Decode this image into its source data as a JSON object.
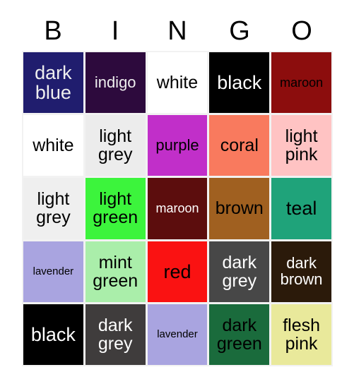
{
  "card": {
    "title": "BINGO",
    "header_letters": [
      "B",
      "I",
      "N",
      "G",
      "O"
    ],
    "background_color": "#ffffff",
    "grid_gap_color": "#f2f2f2"
  },
  "grid": {
    "columns": 5,
    "rows": 5,
    "cells": [
      [
        {
          "label": "dark blue",
          "bg": "#201d6e",
          "fg": "#eeeeee",
          "size": "fs-xl"
        },
        {
          "label": "indigo",
          "bg": "#2d0a3d",
          "fg": "#eeeeee",
          "size": "fs-md"
        },
        {
          "label": "white",
          "bg": "#ffffff",
          "fg": "#000000",
          "size": "fs-lg"
        },
        {
          "label": "black",
          "bg": "#000000",
          "fg": "#ffffff",
          "size": "fs-xl"
        },
        {
          "label": "maroon",
          "bg": "#8c0d0d",
          "fg": "#000000",
          "size": "fs-sm"
        }
      ],
      [
        {
          "label": "white",
          "bg": "#ffffff",
          "fg": "#000000",
          "size": "fs-lg"
        },
        {
          "label": "light grey",
          "bg": "#ececec",
          "fg": "#000000",
          "size": "fs-lg"
        },
        {
          "label": "purple",
          "bg": "#c12fc9",
          "fg": "#000000",
          "size": "fs-md"
        },
        {
          "label": "coral",
          "bg": "#f97a5e",
          "fg": "#000000",
          "size": "fs-lg"
        },
        {
          "label": "light pink",
          "bg": "#ffc3c3",
          "fg": "#000000",
          "size": "fs-lg"
        }
      ],
      [
        {
          "label": "light grey",
          "bg": "#efefef",
          "fg": "#000000",
          "size": "fs-lg"
        },
        {
          "label": "light green",
          "bg": "#3cf43c",
          "fg": "#000000",
          "size": "fs-lg"
        },
        {
          "label": "maroon",
          "bg": "#5c0d0d",
          "fg": "#ffffff",
          "size": "fs-sm"
        },
        {
          "label": "brown",
          "bg": "#a06020",
          "fg": "#000000",
          "size": "fs-lg"
        },
        {
          "label": "teal",
          "bg": "#1fa37a",
          "fg": "#000000",
          "size": "fs-xl"
        }
      ],
      [
        {
          "label": "lavender",
          "bg": "#a9a4e0",
          "fg": "#000000",
          "size": "fs-xs"
        },
        {
          "label": "mint green",
          "bg": "#aaeeaa",
          "fg": "#000000",
          "size": "fs-lg"
        },
        {
          "label": "red",
          "bg": "#fa1212",
          "fg": "#000000",
          "size": "fs-xl"
        },
        {
          "label": "dark grey",
          "bg": "#474747",
          "fg": "#ffffff",
          "size": "fs-lg"
        },
        {
          "label": "dark brown",
          "bg": "#2b1a0a",
          "fg": "#ffffff",
          "size": "fs-md"
        }
      ],
      [
        {
          "label": "black",
          "bg": "#000000",
          "fg": "#ffffff",
          "size": "fs-xl"
        },
        {
          "label": "dark grey",
          "bg": "#3f3c3c",
          "fg": "#ffffff",
          "size": "fs-lg"
        },
        {
          "label": "lavender",
          "bg": "#a9a4e0",
          "fg": "#000000",
          "size": "fs-xs"
        },
        {
          "label": "dark green",
          "bg": "#1a6b3c",
          "fg": "#000000",
          "size": "fs-lg"
        },
        {
          "label": "flesh pink",
          "bg": "#e9e99b",
          "fg": "#000000",
          "size": "fs-lg"
        }
      ]
    ]
  }
}
